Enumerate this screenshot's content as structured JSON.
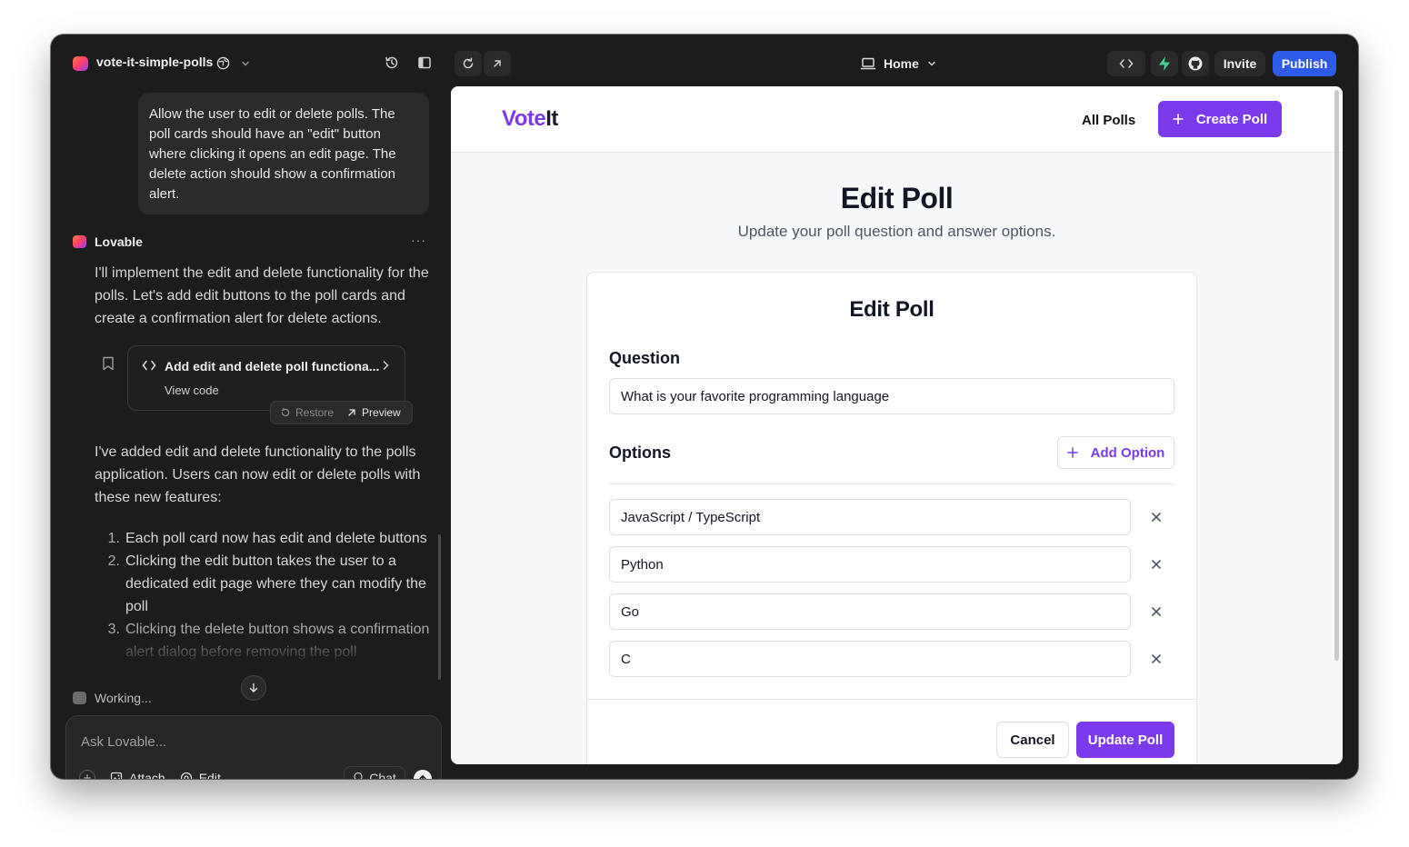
{
  "topbar": {
    "project_name": "vote-it-simple-polls",
    "route": "Home",
    "invite_label": "Invite",
    "publish_label": "Publish"
  },
  "chat": {
    "user_message": "Allow the user to edit or delete polls. The poll cards should have an \"edit\" button where clicking it opens an edit page. The delete action should show a confirmation alert.",
    "assistant_name": "Lovable",
    "assistant_intro": "I'll implement the edit and delete functionality for the polls. Let's add edit buttons to the poll cards and create a confirmation alert for delete actions.",
    "code_card": {
      "title": "Add edit and delete poll functiona...",
      "view_code": "View code",
      "restore": "Restore",
      "preview": "Preview"
    },
    "assistant_summary": "I've added edit and delete functionality to the polls application. Users can now edit or delete polls with these new features:",
    "list": [
      {
        "num": "1.",
        "text": "Each poll card now has edit and delete buttons"
      },
      {
        "num": "2.",
        "text": "Clicking the edit button takes the user to a dedicated edit page where they can modify the poll"
      },
      {
        "num": "3.",
        "text": "Clicking the delete button shows a confirmation alert dialog before removing the poll"
      }
    ],
    "status": "Working...",
    "input_placeholder": "Ask Lovable...",
    "attach_label": "Attach",
    "edit_label": "Edit",
    "chat_mode_label": "Chat"
  },
  "app": {
    "brand_part1": "Vote",
    "brand_part2": "It",
    "nav_all_polls": "All Polls",
    "create_poll_label": "Create Poll",
    "page_title": "Edit Poll",
    "page_subtitle": "Update your poll question and answer options.",
    "card_title": "Edit Poll",
    "question_label": "Question",
    "question_value": "What is your favorite programming language",
    "options_label": "Options",
    "add_option_label": "Add Option",
    "options": [
      "JavaScript / TypeScript",
      "Python",
      "Go",
      "C"
    ],
    "cancel_label": "Cancel",
    "update_label": "Update Poll"
  },
  "colors": {
    "accent": "#7c3aed",
    "publish": "#2f5bea",
    "window_bg": "#1c1c1c"
  }
}
